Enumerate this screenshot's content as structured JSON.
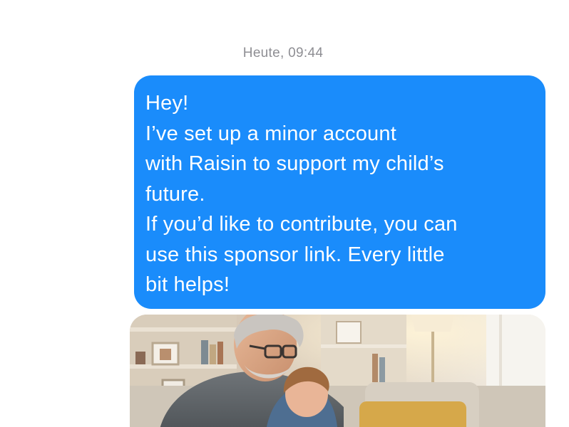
{
  "conversation": {
    "timestamp": "Heute, 09:44"
  },
  "message": {
    "lines": [
      "Hey!",
      "I’ve set up a minor account",
      "with Raisin to support my child’s",
      "future.",
      "If you’d like to contribute, you can",
      "use this sponsor link. Every little",
      "bit helps!"
    ],
    "bubble_color": "#1a8cfb",
    "text_color": "#ffffff"
  },
  "attachment": {
    "type": "photo",
    "depicts": [
      "grandfather",
      "child",
      "armchair",
      "bookshelf",
      "floor-lamp",
      "window"
    ]
  }
}
